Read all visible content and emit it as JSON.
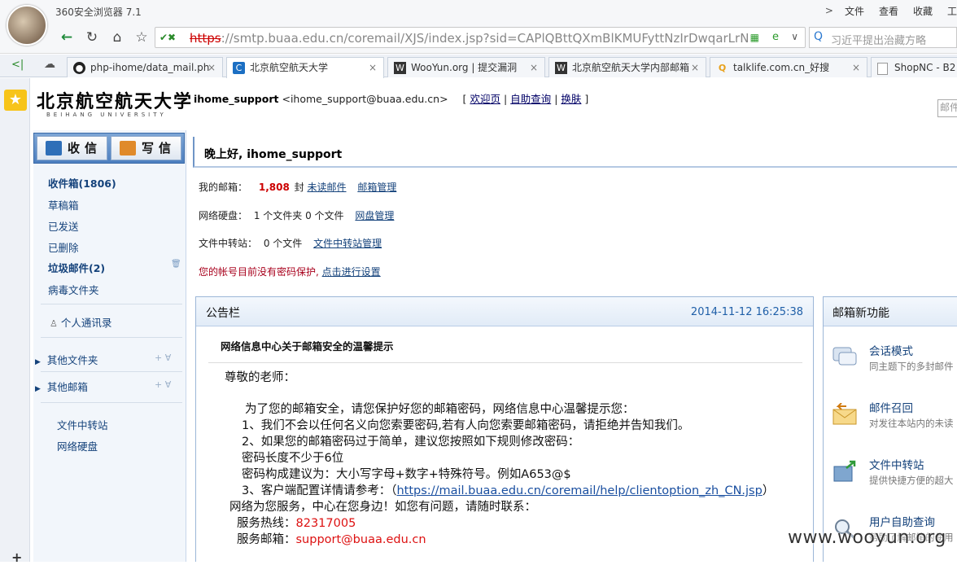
{
  "browser": {
    "title": "360安全浏览器 7.1",
    "menu": [
      "文件",
      "查看",
      "收藏",
      "工"
    ],
    "url_scheme": "https",
    "url_host": "://smtp.buaa.edu.cn",
    "url_path": "/coremail/XJS/index.jsp?sid=CAPlQBttQXmBlKMUFyttNzIrDwqarLrN",
    "search_placeholder": "习近平提出治藏方略",
    "tabs": [
      {
        "label": "php-ihome/data_mail.ph",
        "icon": "github-icon"
      },
      {
        "label": "北京航空航天大学",
        "icon": "coremail-icon"
      },
      {
        "label": "WooYun.org | 提交漏洞",
        "icon": "wooyun-icon"
      },
      {
        "label": "北京航空航天大学内部邮箱",
        "icon": "wooyun-icon"
      },
      {
        "label": "talklife.com.cn_好搜",
        "icon": "haosou-icon"
      },
      {
        "label": "ShopNC - B2",
        "icon": "page-icon"
      }
    ]
  },
  "header": {
    "logo_cn": "北京航空航天大学",
    "logo_en": "BEIHANG UNIVERSITY",
    "username": "ihome_support",
    "email": "<ihome_support@buaa.edu.cn>",
    "link_welcome": "欢迎页",
    "link_selfquery": "自助查询",
    "link_skin": "换肤",
    "search_placeholder": "邮件"
  },
  "toolbar": {
    "receive": "收信",
    "compose": "写信"
  },
  "sidebar": {
    "folders": [
      "收件箱(1806)",
      "草稿箱",
      "已发送",
      "已删除",
      "垃圾邮件(2)",
      "病毒文件夹"
    ],
    "contacts": "个人通讯录",
    "other_folders": "其他文件夹",
    "other_mailboxes": "其他邮箱",
    "transfer": "文件中转站",
    "netdisk": "网络硬盘"
  },
  "main": {
    "greeting": "晚上好, ihome_support",
    "mailbox_label": "我的邮箱：",
    "mailbox_count": "1,808",
    "mailbox_unit": "封",
    "unread_link": "未读邮件",
    "manage_link": "邮箱管理",
    "disk_label": "网络硬盘：",
    "disk_value": "1 个文件夹  0 个文件",
    "disk_link": "网盘管理",
    "transfer_label": "文件中转站：",
    "transfer_value": "0 个文件",
    "transfer_link": "文件中转站管理",
    "security_msg": "您的帐号目前没有密码保护, ",
    "security_link": "点击进行设置"
  },
  "notice": {
    "title": "公告栏",
    "date": "2014-11-12 16:25:38",
    "subject": "网络信息中心关于邮箱安全的温馨提示",
    "lines": [
      "尊敬的老师：",
      "为了您的邮箱安全，请您保护好您的邮箱密码，网络信息中心温馨提示您：",
      "1、我们不会以任何名义向您索要密码,若有人向您索要邮箱密码，请拒绝并告知我们。",
      "2、如果您的邮箱密码过于简单，建议您按照如下规则修改密码：",
      "密码长度不少于6位",
      "密码构成建议为：大小写字母+数字+特殊符号。例如A653@$",
      "3、客户端配置详情请参考：（",
      "https://mail.buaa.edu.cn/coremail/help/clientoption_zh_CN.jsp",
      "）",
      "网络为您服务，中心在您身边！如您有问题，请随时联系：",
      "服务热线：",
      "82317005",
      "服务邮箱：",
      "support@buaa.edu.cn"
    ]
  },
  "features": {
    "title": "邮箱新功能",
    "items": [
      {
        "title": "会话模式",
        "desc": "同主题下的多封邮件",
        "icon": "chat-bubble-icon"
      },
      {
        "title": "邮件召回",
        "desc": "对发往本站内的未读",
        "icon": "envelope-recall-icon"
      },
      {
        "title": "文件中转站",
        "desc": "提供快捷方便的超大",
        "icon": "file-transfer-icon"
      },
      {
        "title": "用户自助查询",
        "desc": "帮助了解邮箱的使用",
        "icon": "magnifier-icon"
      }
    ]
  },
  "watermark": "www.wooyun.org",
  "colors": {
    "link": "#14427b",
    "alert": "#cc0000",
    "panel_border": "#9cb6d7",
    "button_bar": "#4d7fbf",
    "star": "#f7c41a"
  }
}
